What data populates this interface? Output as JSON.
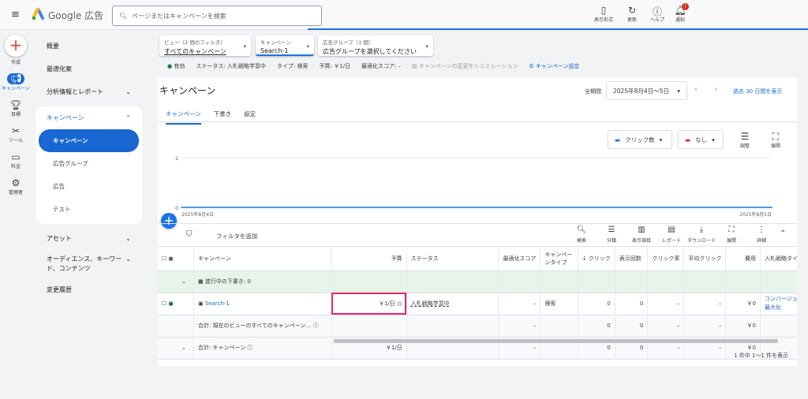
{
  "header": {
    "logo_text": "Google 広告",
    "search_placeholder": "ページまたはキャンペーンを検索",
    "buttons": [
      {
        "label": "表示形式",
        "icon": "appearance-icon"
      },
      {
        "label": "更新",
        "icon": "refresh-icon"
      },
      {
        "label": "ヘルプ",
        "icon": "help-icon"
      },
      {
        "label": "通知",
        "icon": "bell-icon"
      }
    ],
    "notification_badge": "!"
  },
  "rail": [
    {
      "label": "作成",
      "icon": "plus-icon"
    },
    {
      "label": "キャンペーン",
      "icon": "megaphone-icon"
    },
    {
      "label": "目標",
      "icon": "trophy-icon"
    },
    {
      "label": "ツール",
      "icon": "tools-icon"
    },
    {
      "label": "料金",
      "icon": "card-icon"
    },
    {
      "label": "管理者",
      "icon": "gear-icon"
    }
  ],
  "nav": {
    "overview": "概要",
    "recommendations": "最適化案",
    "insights": "分析情報とレポート",
    "campaigns_group": "キャンペーン",
    "sub": [
      "キャンペーン",
      "広告グループ",
      "広告",
      "テスト"
    ],
    "assets": "アセット",
    "audiences": "オーディエンス、キーワード、コンテンツ",
    "history": "変更履歴"
  },
  "selectors": {
    "view_label": "ビュー（2 個のフィルタ）",
    "view_value": "すべてのキャンペーン",
    "campaign_label": "キャンペーン",
    "campaign_value": "Search-1",
    "adgroup_label": "広告グループ（1 個）",
    "adgroup_value": "広告グループを選択してください"
  },
  "info": {
    "enabled": "有効",
    "status": "ステータス: 入札戦略学習中",
    "type": "タイプ: 検索",
    "budget": "予算: ￥1/日",
    "score": "最適化スコア: –",
    "simulate": "キャンペーンの変更をシュミレーション",
    "settings": "キャンペーン設定"
  },
  "page": {
    "title": "キャンペーン",
    "period_label": "全期間",
    "date_range": "2025年8月4日～5日",
    "last30": "過去 30 日間を表示",
    "tabs": [
      "キャンペーン",
      "下書き",
      "設定"
    ]
  },
  "chart_controls": {
    "metric1": "クリック数",
    "metric2": "なし",
    "adjust": "調整",
    "expand": "展開"
  },
  "chart_data": {
    "type": "line",
    "x": [
      "2025年8月4日",
      "2025年8月5日"
    ],
    "series": [
      {
        "values": [
          0,
          0
        ],
        "color": "#1a73e8"
      }
    ],
    "ylim": [
      0,
      2
    ],
    "yticks": [
      0,
      2
    ],
    "grid": true
  },
  "toolbar": {
    "filter": "フィルタを追加",
    "buttons": [
      "検索",
      "分類",
      "表示項目",
      "レポート",
      "ダウンロード",
      "展開",
      "詳細"
    ]
  },
  "table": {
    "headers": [
      "キャンペーン",
      "予算",
      "ステータス",
      "最適化スコア",
      "キャンペーンタイプ",
      "↓ クリック",
      "表示回数",
      "クリック率",
      "平均クリック",
      "費用",
      "入札戦略タイプ"
    ],
    "draft_row": "進行中の下書き: 0",
    "rows": [
      {
        "name": "Search-1",
        "budget": "￥1/日",
        "status": "入札戦略学習中",
        "score": "–",
        "type": "検索",
        "clicks": "0",
        "impr": "0",
        "ctr": "–",
        "cpc": "–",
        "cost": "￥0",
        "bid": "コンバージョン数の最大化"
      }
    ],
    "total_view": {
      "label": "合計: 現在のビューのすべてのキャンペーン…",
      "score": "–",
      "clicks": "0",
      "impr": "0",
      "ctr": "–",
      "cpc": "–",
      "cost": "￥0"
    },
    "total_campaign": {
      "label": "合計: キャンペーン",
      "budget": "￥1/日",
      "score": "–",
      "clicks": "0",
      "impr": "0",
      "ctr": "–",
      "cpc": "–",
      "cost": "￥0"
    },
    "pagination": "1 件中 1～1 件を表示"
  }
}
